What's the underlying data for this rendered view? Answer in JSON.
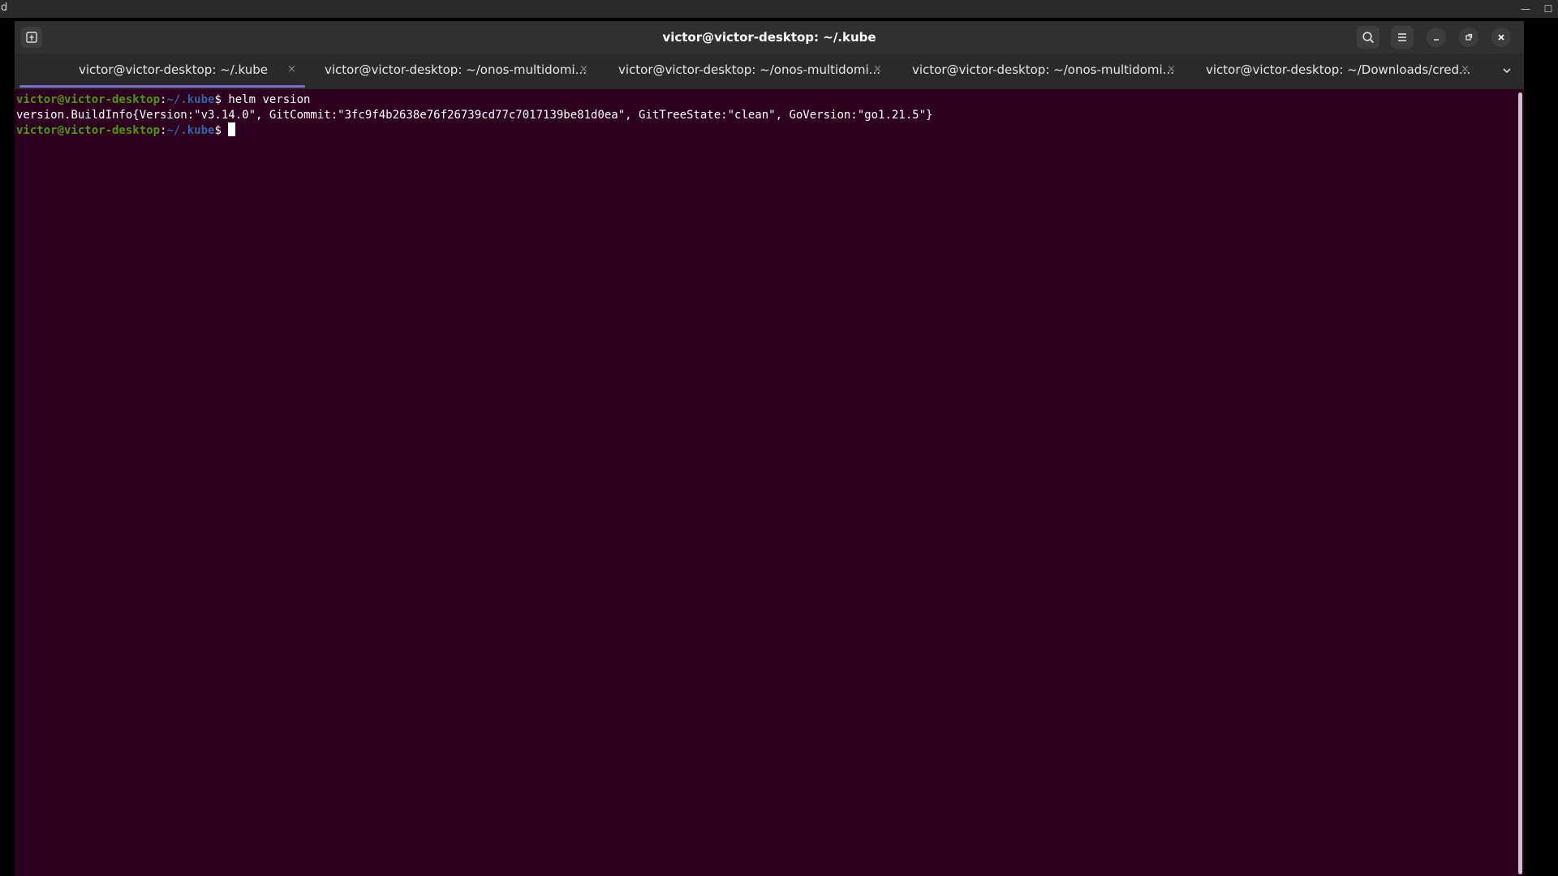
{
  "outer": {
    "left_glyph": "d",
    "minimize_glyph": "—",
    "maximize_glyph": "☐"
  },
  "window": {
    "title": "victor@victor-desktop: ~/.kube"
  },
  "tabs": [
    {
      "label": "victor@victor-desktop: ~/.kube",
      "close": "×",
      "active": true
    },
    {
      "label": "victor@victor-desktop: ~/onos-multidomi...",
      "close": "×",
      "active": false
    },
    {
      "label": "victor@victor-desktop: ~/onos-multidomi...",
      "close": "×",
      "active": false
    },
    {
      "label": "victor@victor-desktop: ~/onos-multidomi...",
      "close": "×",
      "active": false
    },
    {
      "label": "victor@victor-desktop: ~/Downloads/cred...",
      "close": "×",
      "active": false
    }
  ],
  "terminal": {
    "lines": [
      {
        "user": "victor@victor-desktop",
        "sep": ":",
        "path": "~/.kube",
        "dollar": "$ ",
        "command": "helm version"
      },
      {
        "output": "version.BuildInfo{Version:\"v3.14.0\", GitCommit:\"3fc9f4b2638e76f26739cd77c7017139be81d0ea\", GitTreeState:\"clean\", GoVersion:\"go1.21.5\"}"
      },
      {
        "user": "victor@victor-desktop",
        "sep": ":",
        "path": "~/.kube",
        "dollar": "$ ",
        "command": ""
      }
    ]
  },
  "icons": {
    "new_tab": "new-tab-icon",
    "search": "search-icon",
    "menu": "hamburger-menu-icon",
    "minimize": "minimize-icon",
    "restore": "restore-icon",
    "close": "close-icon",
    "tabs_dropdown": "chevron-down-icon"
  },
  "colors": {
    "terminal_bg": "#2c001e",
    "prompt_user": "#4e9a06",
    "prompt_path": "#3465a4",
    "active_tab_accent": "#7c6ad6"
  }
}
